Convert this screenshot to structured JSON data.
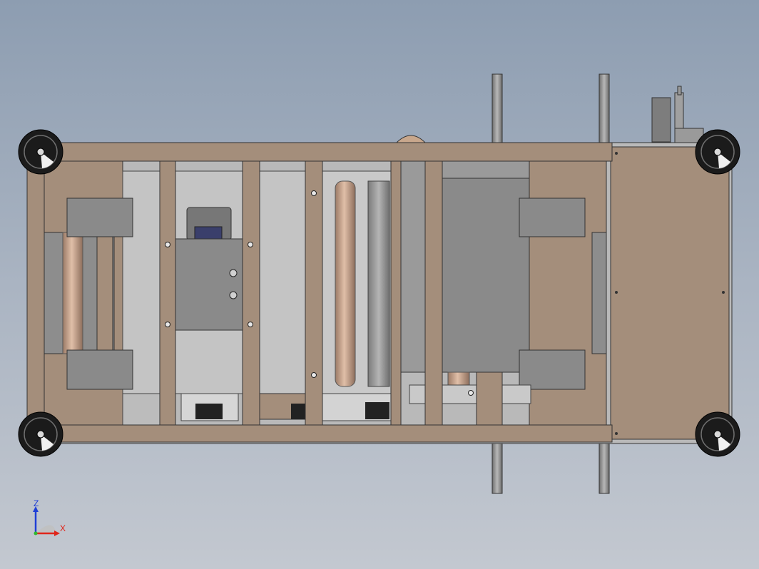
{
  "viewport": {
    "background_top": "#8d9db1",
    "background_bottom": "#c3c8d0"
  },
  "model": {
    "frame_color": "#a48e7b",
    "panel_gray": "#bdbdbd",
    "plate_gray": "#8a8a8a",
    "roller_color": "#c19a80",
    "post_color": "#8f8f8f",
    "wheel_color": "#1b1b1b"
  },
  "triad": {
    "z_label": "Z",
    "x_label": "X",
    "z_color": "#1f3fd6",
    "x_color": "#e0261b",
    "origin_color": "#2eb82e"
  }
}
